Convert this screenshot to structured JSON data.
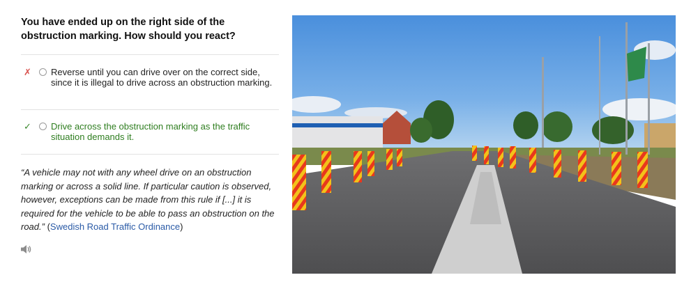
{
  "question": "You have ended up on the right side of the obstruction marking. How should you react?",
  "answers": [
    {
      "mark": "✗",
      "text": "Reverse until you can drive over on the correct side, since it is illegal to drive across an obstruction marking."
    },
    {
      "mark": "✓",
      "text": "Drive across the obstruction marking as the traffic situation demands it."
    }
  ],
  "explanation": {
    "quote": "“A vehicle may not with any wheel drive on an obstruction marking or across a solid line. If particular caution is observed, however, exceptions can be made from this rule if [...] it is required for the vehicle to be able to pass an obstruction on the road.”",
    "source_open": " (",
    "source_link": "Swedish Road Traffic Ordinance",
    "source_close": ")"
  },
  "colors": {
    "wrong": "#d9534f",
    "correct": "#2e7d1f",
    "link": "#2a5aa6"
  },
  "icons": {
    "audio": "speaker-icon"
  }
}
